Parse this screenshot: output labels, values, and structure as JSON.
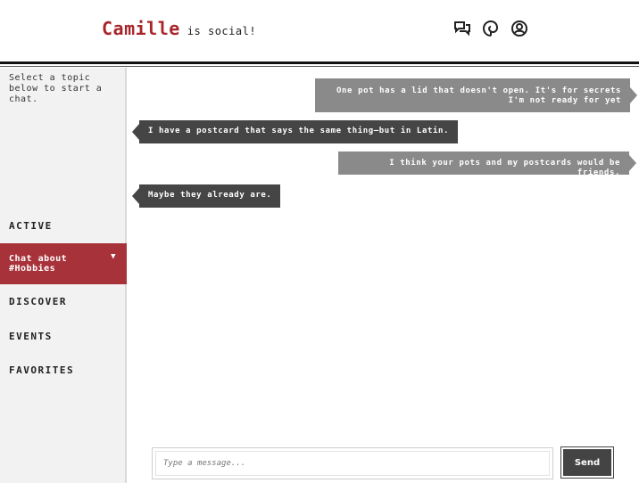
{
  "header": {
    "brand_name": "Camille",
    "brand_tagline": "is social!",
    "icons": [
      "chat-bubbles-icon",
      "spiral-icon",
      "user-circle-icon"
    ]
  },
  "sidebar": {
    "intro": "Select a topic below to start a chat.",
    "active_label": "ACTIVE",
    "current_chat": "Chat about #Hobbies",
    "discover_label": "DISCOVER",
    "events_label": "EVENTS",
    "favorites_label": "FAVORITES"
  },
  "messages": [
    {
      "direction": "out",
      "text": "One pot has a lid that doesn't open. It's for secrets I'm not ready for yet"
    },
    {
      "direction": "in",
      "text": "I have a postcard that says the same thing—but in Latin."
    },
    {
      "direction": "out",
      "text": "I think your pots and my postcards would be friends."
    },
    {
      "direction": "in",
      "text": "Maybe they already are."
    }
  ],
  "composer": {
    "placeholder": "Type a message...",
    "send_label": "Send"
  },
  "colors": {
    "accent": "#a8323a",
    "outgoing_bubble": "#8a8a8a",
    "incoming_bubble": "#454545"
  }
}
